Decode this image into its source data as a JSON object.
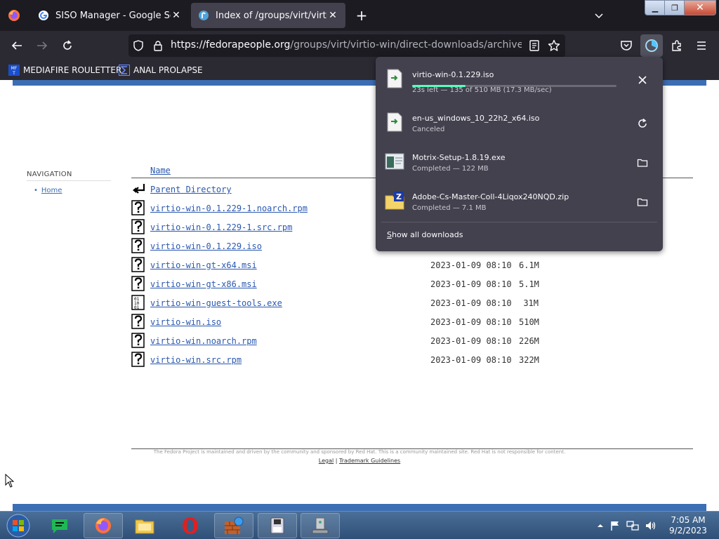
{
  "browser": {
    "tabs": [
      {
        "title": "SISO Manager - Google Search",
        "active": false
      },
      {
        "title": "Index of /groups/virt/virtio-win",
        "active": true
      }
    ],
    "url": {
      "host": "https://fedorapeople.org",
      "path": "/groups/virt/virtio-win/direct-downloads/archive-virtio/vir"
    },
    "bookmarks": [
      {
        "label": "MEDIAFIRE ROULETTER"
      },
      {
        "label": "ANAL PROLAPSE"
      }
    ]
  },
  "sidebar": {
    "heading": "NAVIGATION",
    "home_label": "Home"
  },
  "listing": {
    "name_header": "Name",
    "parent_label": "Parent Directory",
    "files": [
      {
        "name": "virtio-win-0.1.229-1.noarch.rpm",
        "date": "",
        "size": "",
        "icon": "unknown-file-icon"
      },
      {
        "name": "virtio-win-0.1.229-1.src.rpm",
        "date": "",
        "size": "",
        "icon": "unknown-file-icon"
      },
      {
        "name": "virtio-win-0.1.229.iso",
        "date": "",
        "size": "",
        "icon": "unknown-file-icon"
      },
      {
        "name": "virtio-win-gt-x64.msi",
        "date": "2023-01-09 08:10",
        "size": "6.1M",
        "icon": "unknown-file-icon"
      },
      {
        "name": "virtio-win-gt-x86.msi",
        "date": "2023-01-09 08:10",
        "size": "5.1M",
        "icon": "unknown-file-icon"
      },
      {
        "name": "virtio-win-guest-tools.exe",
        "date": "2023-01-09 08:10",
        "size": "31M",
        "icon": "binary-file-icon"
      },
      {
        "name": "virtio-win.iso",
        "date": "2023-01-09 08:10",
        "size": "510M",
        "icon": "unknown-file-icon"
      },
      {
        "name": "virtio-win.noarch.rpm",
        "date": "2023-01-09 08:10",
        "size": "226M",
        "icon": "unknown-file-icon"
      },
      {
        "name": "virtio-win.src.rpm",
        "date": "2023-01-09 08:10",
        "size": "322M",
        "icon": "unknown-file-icon"
      }
    ]
  },
  "footer": {
    "text": "The Fedora Project is maintained and driven by the community and sponsored by Red Hat. This is a community maintained site. Red Hat is not responsible for content.",
    "legal": "Legal",
    "separator": "|",
    "trademark": "Trademark Guidelines"
  },
  "downloads": {
    "items": [
      {
        "name": "virtio-win-0.1.229.iso",
        "status": "23s left — 135 of 510 MB (17.3 MB/sec)",
        "progress": 0.26,
        "action": "cancel"
      },
      {
        "name": "en-us_windows_10_22h2_x64.iso",
        "status": "Canceled",
        "action": "retry"
      },
      {
        "name": "Motrix-Setup-1.8.19.exe",
        "status": "Completed — 122 MB",
        "action": "open-folder"
      },
      {
        "name": "Adobe-Cs-Master-Coll-4Liqox240NQD.zip",
        "status": "Completed — 7.1 MB",
        "action": "open-folder"
      }
    ],
    "show_all": "Show all downloads"
  },
  "taskbar": {
    "time": "7:05 AM",
    "date": "9/2/2023"
  },
  "colors": {
    "fedora_blue": "#3c6eb4",
    "link": "#2a58b0",
    "progress": "#54ffbd",
    "panel": "#42414d"
  }
}
